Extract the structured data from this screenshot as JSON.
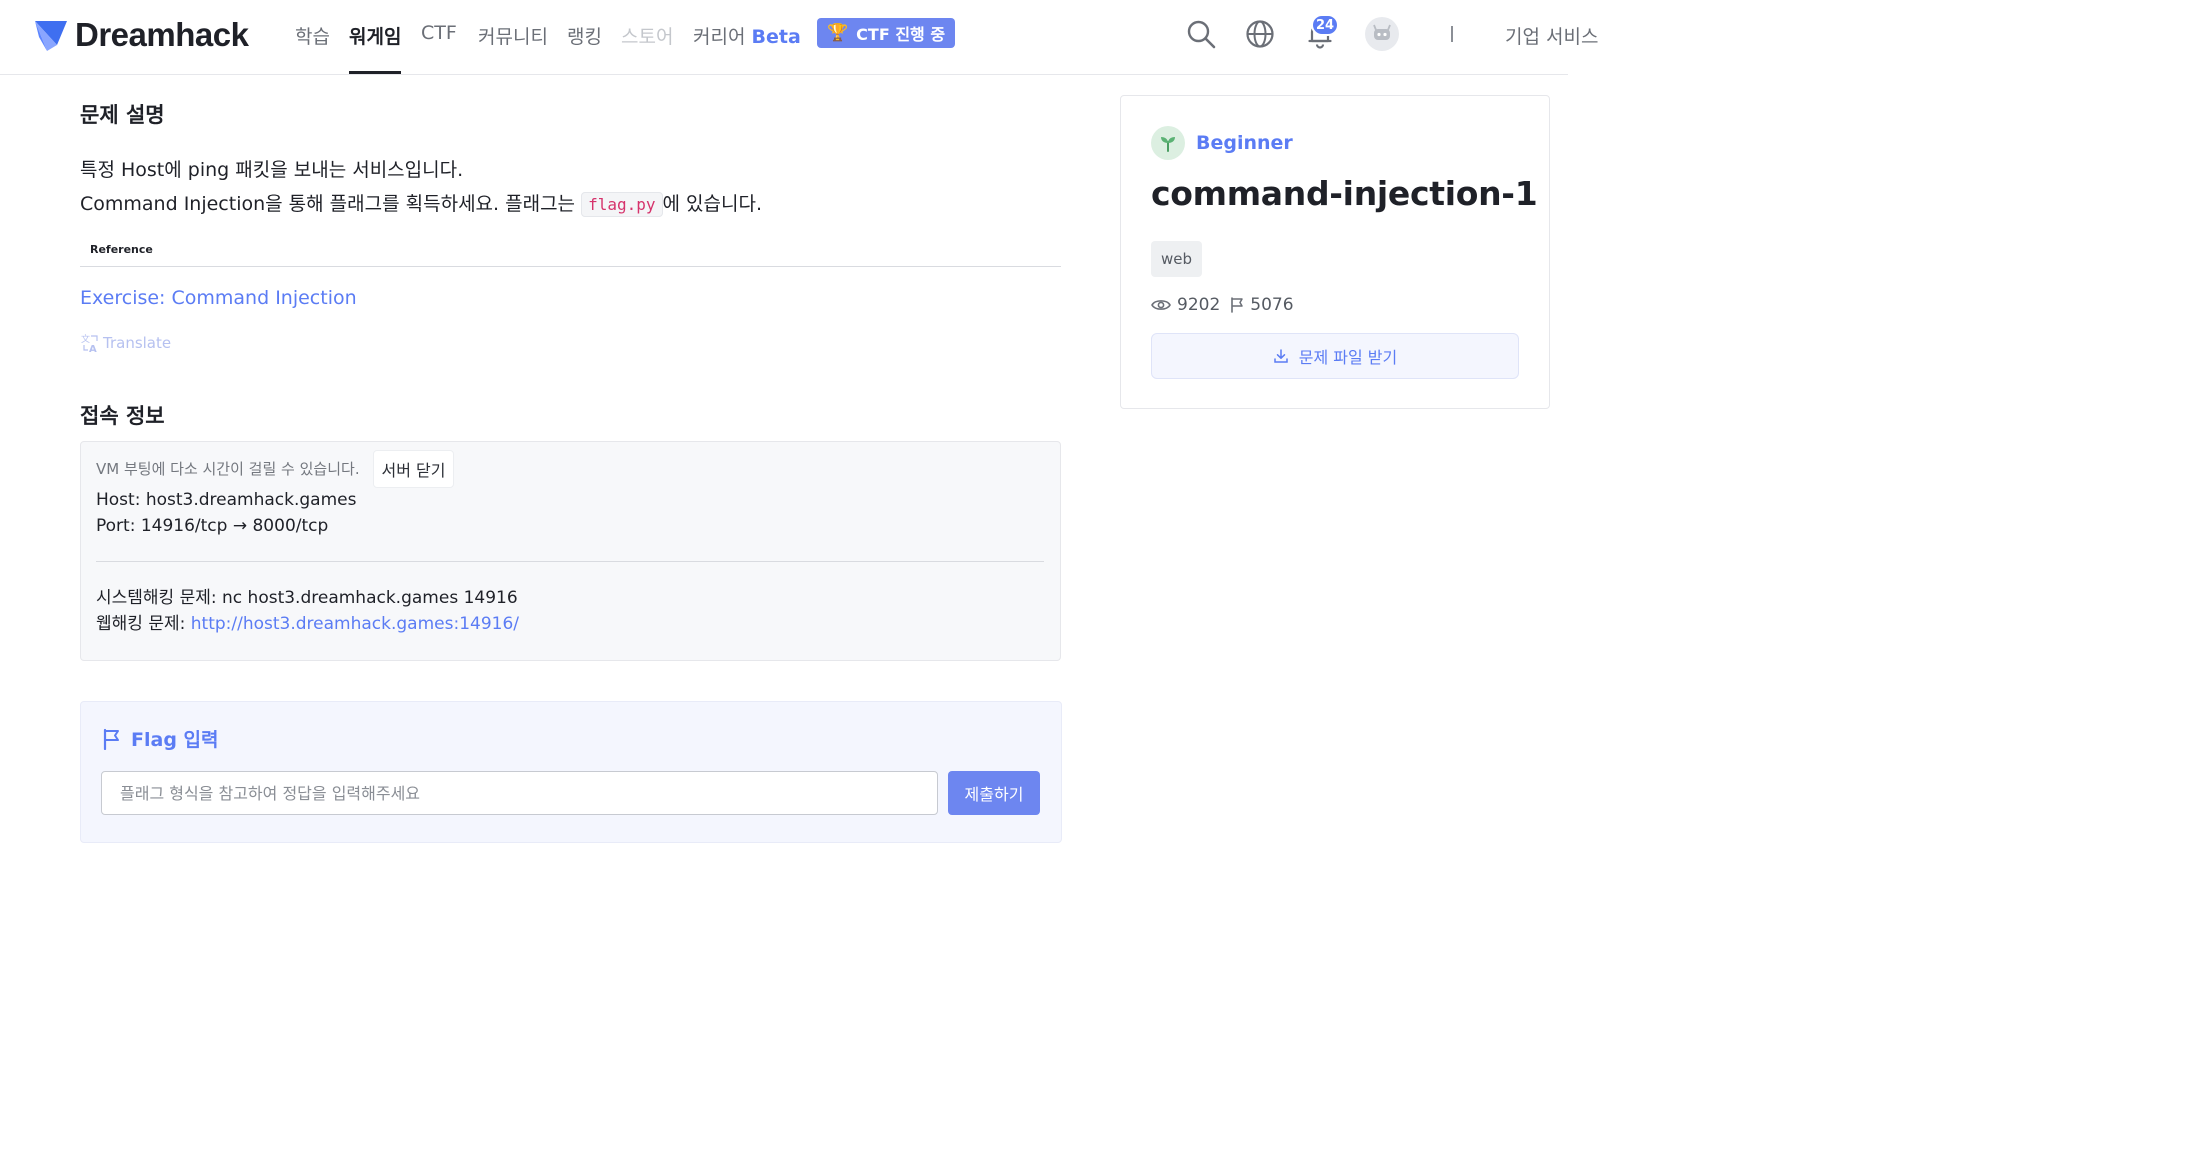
{
  "nav": {
    "brand": "Dreamhack",
    "items": [
      "학습",
      "워게임",
      "CTF",
      "커뮤니티",
      "랭킹",
      "스토어"
    ],
    "career": "커리어",
    "beta": "Beta",
    "ctf_badge": "CTF 진행 중",
    "notification_count": "24",
    "company": "기업 서비스"
  },
  "description": {
    "title": "문제 설명",
    "line1": "특정 Host에 ping 패킷을 보내는 서비스입니다.",
    "line2_prefix": "Command Injection을 통해 플래그를 획득하세요. 플래그는",
    "line2_code": "flag.py",
    "line2_suffix": "에 있습니다.",
    "reference_label": "Reference",
    "reference_link": "Exercise: Command Injection",
    "translate": "Translate"
  },
  "connection": {
    "title": "접속 정보",
    "vm_note": "VM 부팅에 다소 시간이 걸릴 수 있습니다.",
    "close_button": "서버 닫기",
    "host": "Host: host3.dreamhack.games",
    "port": "Port:  14916/tcp → 8000/tcp",
    "system_hacking": "시스템해킹 문제: nc host3.dreamhack.games 14916",
    "web_hacking_label": "웹해킹 문제:",
    "web_hacking_url": "http://host3.dreamhack.games:14916/"
  },
  "flag": {
    "title": "Flag 입력",
    "placeholder": "플래그 형식을 참고하여 정답을 입력해주세요",
    "submit": "제출하기"
  },
  "challenge": {
    "level": "Beginner",
    "title": "command-injection-1",
    "tag": "web",
    "views": "9202",
    "solves": "5076",
    "download": "문제 파일 받기"
  },
  "colors": {
    "accent": "#5b7cf4",
    "ctf_badge": "#6d86f0",
    "code": "#d6336c"
  }
}
